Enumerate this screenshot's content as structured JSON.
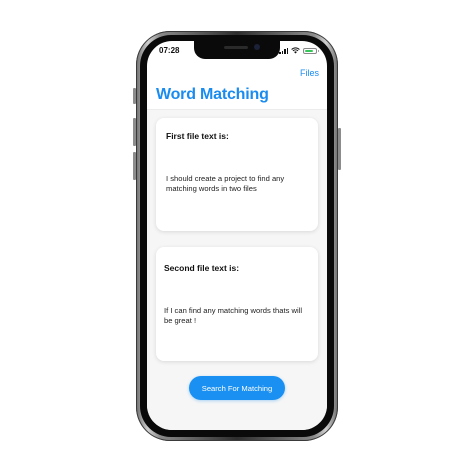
{
  "status_bar": {
    "time": "07:28"
  },
  "nav": {
    "files_label": "Files"
  },
  "page": {
    "title": "Word Matching"
  },
  "cards": [
    {
      "heading": "First file text is:",
      "body": "I should create a project to find any matching words in two files"
    },
    {
      "heading": "Second file text is:",
      "body": "If I can find any matching words thats will be great !"
    }
  ],
  "actions": {
    "search_label": "Search For Matching"
  },
  "colors": {
    "accent": "#1a8cf0",
    "button": "#1a90f2",
    "battery": "#35c759"
  }
}
